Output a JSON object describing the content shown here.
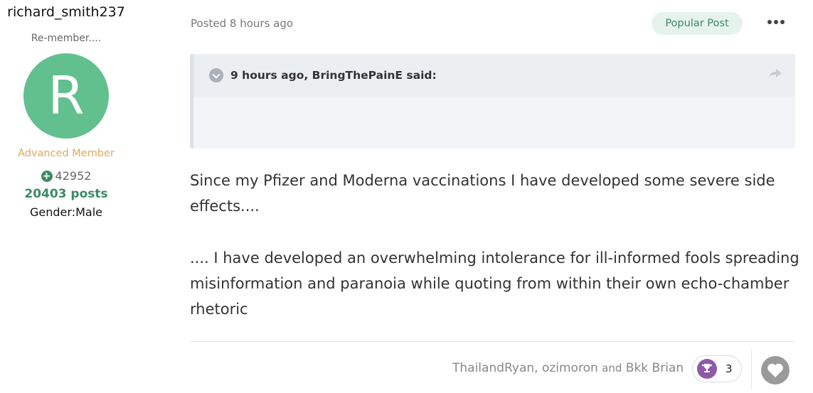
{
  "author": {
    "username": "richard_smith237",
    "title": "Re-member....",
    "avatar_letter": "R",
    "avatar_color": "#62c08f",
    "rank": "Advanced Member",
    "reputation": "42952",
    "posts": "20403 posts",
    "gender": "Gender:Male"
  },
  "post": {
    "posted": "Posted 8 hours ago",
    "badge": "Popular Post",
    "quote": {
      "citation": "9 hours ago, BringThePainE said:"
    },
    "paragraphs": [
      " Since my Pfizer and Moderna vaccinations I have developed some severe side effects....",
      ".... I have developed an overwhelming intolerance for ill-informed fools spreading misinformation and paranoia while quoting from within their own echo-chamber rhetoric"
    ]
  },
  "reactions": {
    "users_part1": "ThailandRyan, ozimoron",
    "and": "and",
    "users_part2": "Bkk Brian",
    "count": "3",
    "trophy_color": "#8e5aa8"
  },
  "colors": {
    "accent_green": "#3b8a66",
    "rank_orange": "#e8a55a",
    "badge_bg": "#e6f3ec"
  },
  "icons": [
    "plus-circle-icon",
    "chevron-down-icon",
    "share-icon",
    "ellipsis-icon",
    "trophy-icon",
    "heart-icon"
  ]
}
